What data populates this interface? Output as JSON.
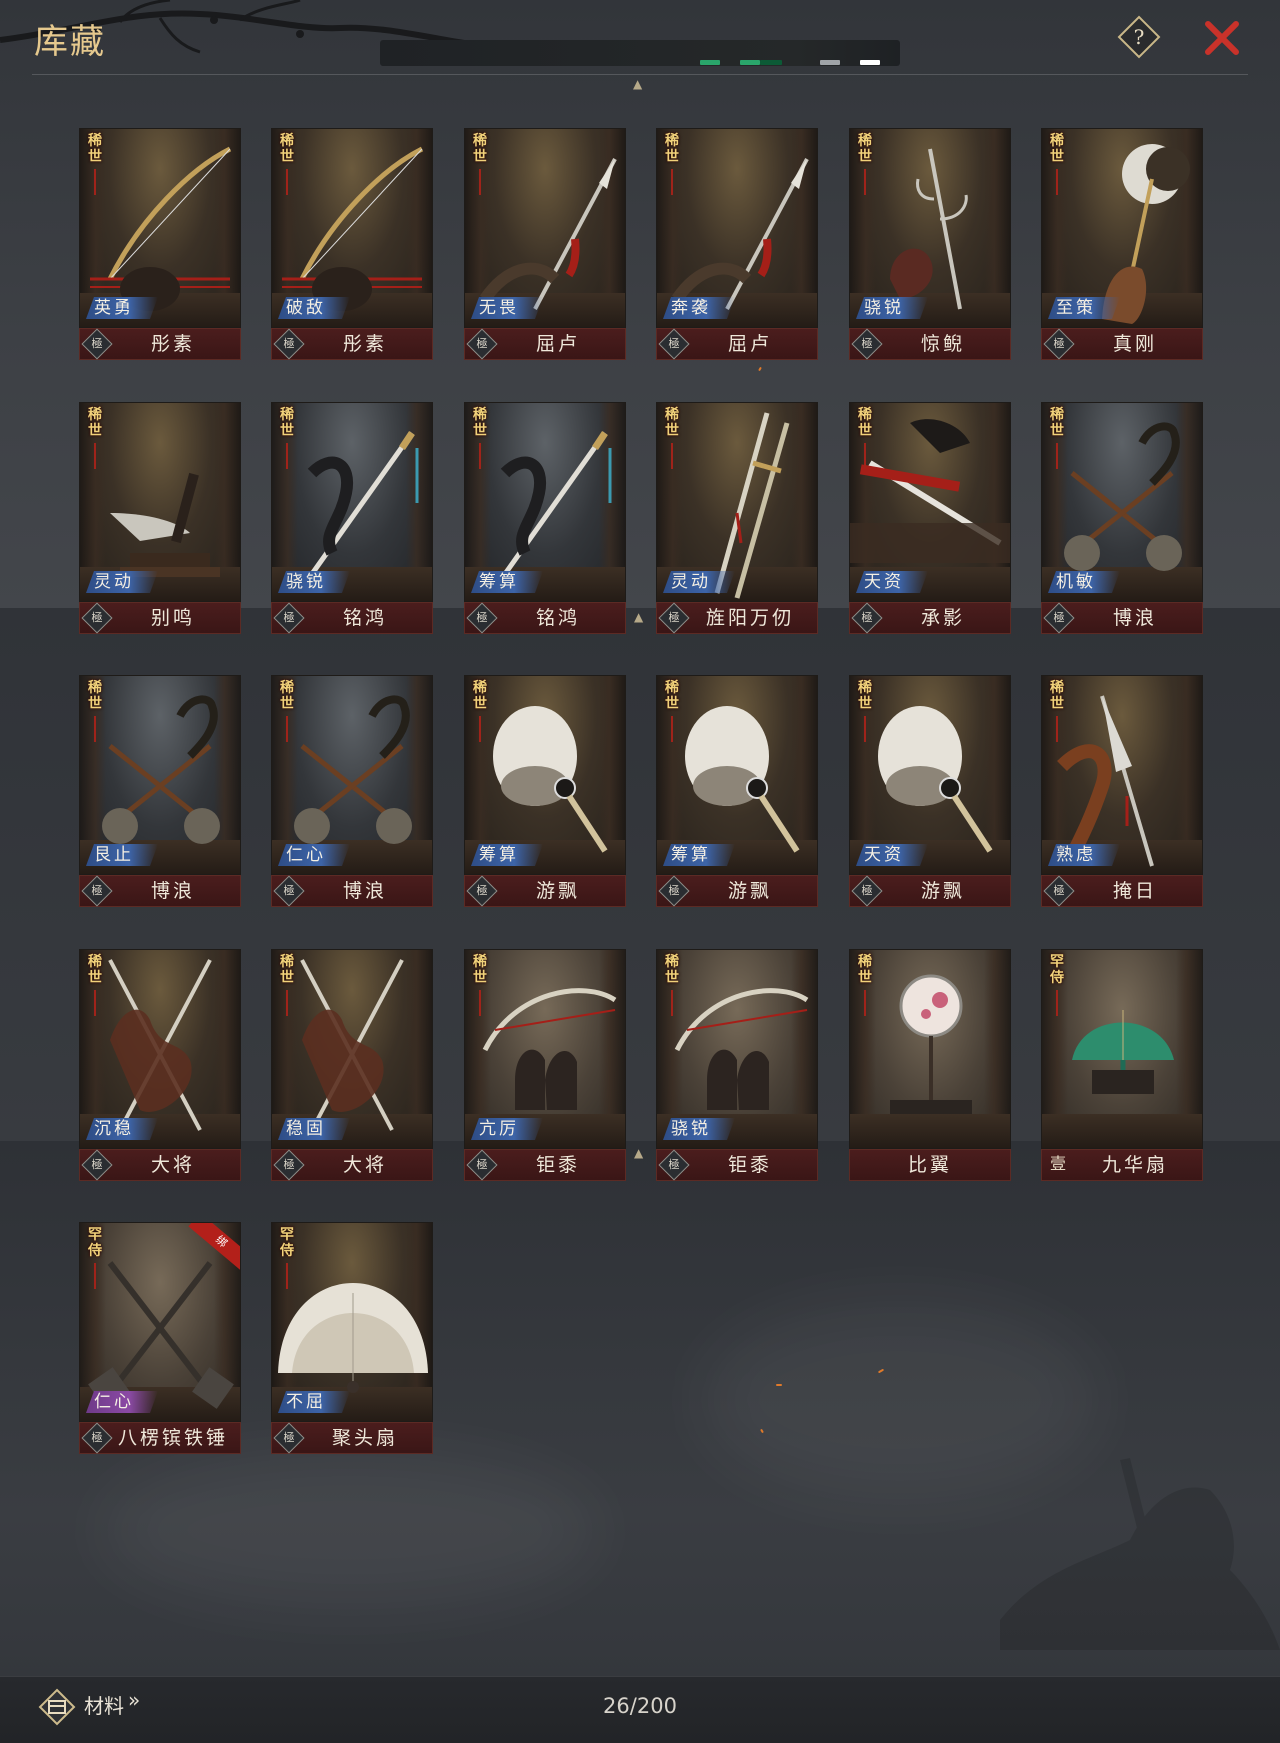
{
  "header": {
    "title": "库藏",
    "help_icon": "question-icon",
    "close_icon": "close-icon",
    "accent_color": "#c9322a"
  },
  "notice_bar": {
    "indicators": [
      "#2aa56b",
      "#2aa56b",
      "#0c5a36",
      "#a0a4a8",
      "#ffffff"
    ]
  },
  "items": [
    {
      "rarity": "稀世",
      "tag": "英勇",
      "grade": "極",
      "name": "彤素",
      "weapon": "bow"
    },
    {
      "rarity": "稀世",
      "tag": "破敌",
      "grade": "極",
      "name": "彤素",
      "weapon": "bow"
    },
    {
      "rarity": "稀世",
      "tag": "无畏",
      "grade": "極",
      "name": "屈卢",
      "weapon": "spear"
    },
    {
      "rarity": "稀世",
      "tag": "奔袭",
      "grade": "極",
      "name": "屈卢",
      "weapon": "spear"
    },
    {
      "rarity": "稀世",
      "tag": "骁锐",
      "grade": "極",
      "name": "惊鲵",
      "weapon": "halberd"
    },
    {
      "rarity": "稀世",
      "tag": "至策",
      "grade": "極",
      "name": "真刚",
      "weapon": "axe"
    },
    {
      "rarity": "稀世",
      "tag": "灵动",
      "grade": "極",
      "name": "别鸣",
      "weapon": "dagger"
    },
    {
      "rarity": "稀世",
      "tag": "骁锐",
      "grade": "極",
      "name": "铭鸿",
      "weapon": "sword"
    },
    {
      "rarity": "稀世",
      "tag": "筹算",
      "grade": "極",
      "name": "铭鸿",
      "weapon": "sword"
    },
    {
      "rarity": "稀世",
      "tag": "灵动",
      "grade": "極",
      "name": "旌阳万仞",
      "weapon": "twinswords"
    },
    {
      "rarity": "稀世",
      "tag": "天资",
      "grade": "極",
      "name": "承影",
      "weapon": "swordflat"
    },
    {
      "rarity": "稀世",
      "tag": "机敏",
      "grade": "極",
      "name": "博浪",
      "weapon": "hammers"
    },
    {
      "rarity": "稀世",
      "tag": "艮止",
      "grade": "極",
      "name": "博浪",
      "weapon": "hammers"
    },
    {
      "rarity": "稀世",
      "tag": "仁心",
      "grade": "極",
      "name": "博浪",
      "weapon": "hammers"
    },
    {
      "rarity": "稀世",
      "tag": "筹算",
      "grade": "極",
      "name": "游飘",
      "weapon": "featherfan"
    },
    {
      "rarity": "稀世",
      "tag": "筹算",
      "grade": "極",
      "name": "游飘",
      "weapon": "featherfan"
    },
    {
      "rarity": "稀世",
      "tag": "天资",
      "grade": "極",
      "name": "游飘",
      "weapon": "featherfan"
    },
    {
      "rarity": "稀世",
      "tag": "熟虑",
      "grade": "極",
      "name": "掩日",
      "weapon": "glaive"
    },
    {
      "rarity": "稀世",
      "tag": "沉稳",
      "grade": "極",
      "name": "大将",
      "weapon": "twinspears"
    },
    {
      "rarity": "稀世",
      "tag": "稳固",
      "grade": "極",
      "name": "大将",
      "weapon": "twinspears"
    },
    {
      "rarity": "稀世",
      "tag": "亢厉",
      "grade": "極",
      "name": "钜黍",
      "weapon": "crossbow"
    },
    {
      "rarity": "稀世",
      "tag": "骁锐",
      "grade": "極",
      "name": "钜黍",
      "weapon": "crossbow"
    },
    {
      "rarity": "稀世",
      "tag": "",
      "grade": "",
      "name": "比翼",
      "weapon": "roundfan"
    },
    {
      "rarity": "罕侍",
      "tag": "",
      "grade": "壹",
      "name": "九华扇",
      "weapon": "jadefan"
    },
    {
      "rarity": "罕侍",
      "tag": "仁心",
      "grade": "極",
      "name": "八楞镔铁锤",
      "weapon": "maces",
      "tag_color": "purple",
      "bound": "绑"
    },
    {
      "rarity": "罕侍",
      "tag": "不屈",
      "grade": "極",
      "name": "聚头扇",
      "weapon": "whitefan"
    }
  ],
  "footer": {
    "materials_label": "材料",
    "materials_arrow": "»",
    "materials_icon": "chest-icon",
    "capacity": "26/200"
  }
}
